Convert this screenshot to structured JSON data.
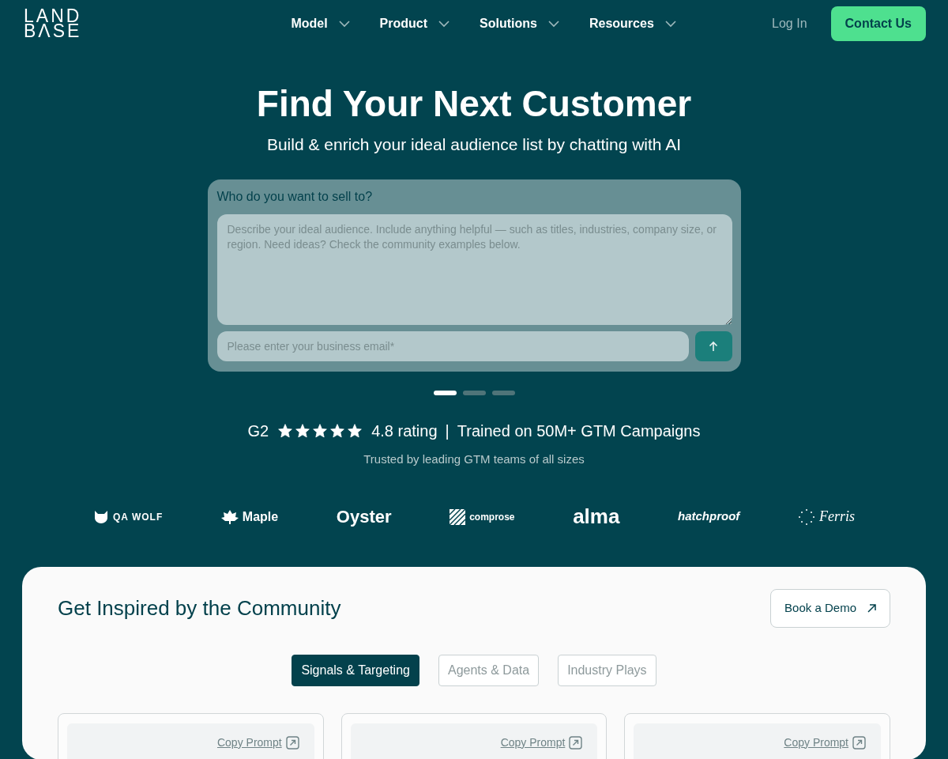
{
  "logo": {
    "line_1": "LAND",
    "line_2": "BΛSE"
  },
  "nav": {
    "menus": [
      {
        "label": "Model"
      },
      {
        "label": "Product"
      },
      {
        "label": "Solutions"
      },
      {
        "label": "Resources"
      }
    ],
    "login": "Log In",
    "contact": "Contact Us"
  },
  "hero": {
    "title": "Find Your Next Customer",
    "subtitle": "Build & enrich your ideal audience list by chatting with AI"
  },
  "form": {
    "label": "Who do you want to sell to?",
    "audience": {
      "placeholder": "Describe your ideal audience. Include anything helpful — such as titles, industries, company size, or region. Need ideas? Check the community examples below."
    },
    "email": {
      "placeholder": "Please enter your business email*"
    }
  },
  "carousel_dots": [
    {
      "selected": true
    },
    {
      "selected": false
    },
    {
      "selected": false
    }
  ],
  "rating": {
    "brand": "G2",
    "stars": 5,
    "score": "4.8 rating",
    "separator": "|",
    "claim": "Trained on 50M+ GTM Campaigns",
    "trusted": "Trusted by leading GTM teams of all sizes"
  },
  "logos": [
    {
      "kind": "wolf",
      "name": "QA WOLF"
    },
    {
      "kind": "leaf",
      "name": "Maple"
    },
    {
      "kind": "plain",
      "name": "Oyster"
    },
    {
      "kind": "grid",
      "name": "comprose"
    },
    {
      "kind": "round",
      "name": "alma"
    },
    {
      "kind": "italic",
      "name": "hatchproof"
    },
    {
      "kind": "dots",
      "name": "Ferris"
    }
  ],
  "community": {
    "title": "Get Inspired by the Community",
    "demo_button": "Book a Demo",
    "tabs": [
      {
        "label": "Signals & Targeting",
        "selected": true
      },
      {
        "label": "Agents & Data",
        "selected": false
      },
      {
        "label": "Industry Plays",
        "selected": false
      }
    ],
    "cards": [
      {
        "action": "Copy Prompt"
      },
      {
        "action": "Copy Prompt"
      },
      {
        "action": "Copy Prompt"
      }
    ]
  }
}
